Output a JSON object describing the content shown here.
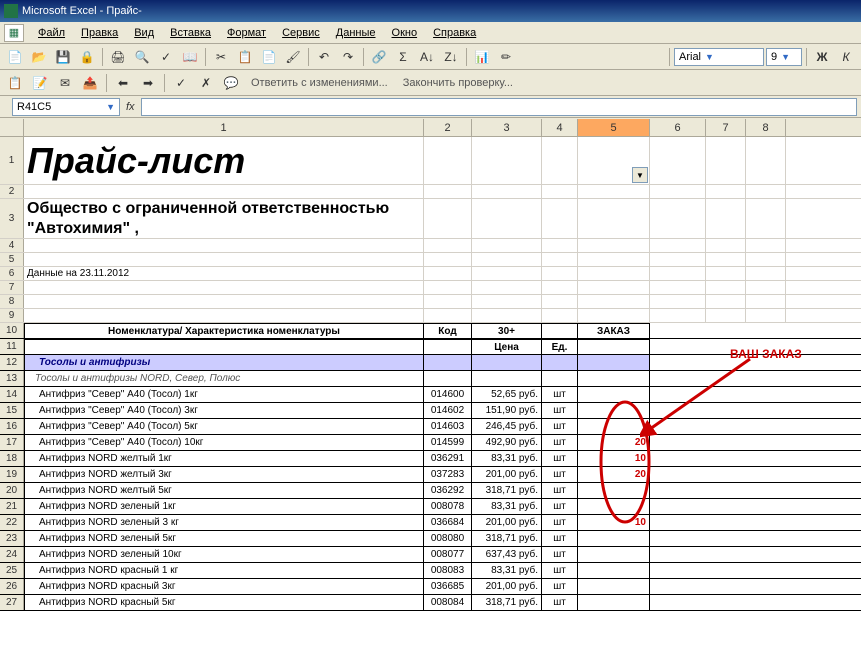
{
  "app_title": "Microsoft Excel - Прайс-",
  "menu": [
    "Файл",
    "Правка",
    "Вид",
    "Вставка",
    "Формат",
    "Сервис",
    "Данные",
    "Окно",
    "Справка"
  ],
  "review_bar": {
    "reply": "Ответить с изменениями...",
    "end": "Закончить проверку..."
  },
  "font": {
    "name": "Arial",
    "size": "9"
  },
  "format_buttons": {
    "bold": "Ж",
    "italic": "К"
  },
  "namebox": "R41C5",
  "col_numbers": [
    "1",
    "2",
    "3",
    "4",
    "5",
    "6",
    "7",
    "8"
  ],
  "title": "Прайс-лист",
  "company": "Общество с ограниченной ответственностью  \"Автохимия\"  ,",
  "date_line": "Данные на 23.11.2012",
  "headers": {
    "nomen": "Номенклатура/ Характеристика номенклатуры",
    "code": "Код",
    "thirty": "30+",
    "price": "Цена",
    "unit": "Ед.",
    "order": "ЗАКАЗ"
  },
  "section": "Тосолы и антифризы",
  "group": "Тосолы и антифризы NORD, Север, Полюс",
  "rows": [
    {
      "n": "14",
      "name": "Антифриз \"Север\" А40 (Тосол)   1кг",
      "code": "014600",
      "price": "52,65 руб.",
      "unit": "шт",
      "order": ""
    },
    {
      "n": "15",
      "name": "Антифриз \"Север\" А40 (Тосол)   3кг",
      "code": "014602",
      "price": "151,90 руб.",
      "unit": "шт",
      "order": ""
    },
    {
      "n": "16",
      "name": "Антифриз \"Север\" А40 (Тосол)   5кг",
      "code": "014603",
      "price": "246,45 руб.",
      "unit": "шт",
      "order": ""
    },
    {
      "n": "17",
      "name": "Антифриз \"Север\" А40 (Тосол)  10кг",
      "code": "014599",
      "price": "492,90 руб.",
      "unit": "шт",
      "order": "20"
    },
    {
      "n": "18",
      "name": "Антифриз NORD желтый  1кг",
      "code": "036291",
      "price": "83,31 руб.",
      "unit": "шт",
      "order": "10"
    },
    {
      "n": "19",
      "name": "Антифриз NORD желтый  3кг",
      "code": "037283",
      "price": "201,00 руб.",
      "unit": "шт",
      "order": "20"
    },
    {
      "n": "20",
      "name": "Антифриз NORD желтый  5кг",
      "code": "036292",
      "price": "318,71 руб.",
      "unit": "шт",
      "order": ""
    },
    {
      "n": "21",
      "name": "Антифриз NORD зеленый  1кг",
      "code": "008078",
      "price": "83,31 руб.",
      "unit": "шт",
      "order": ""
    },
    {
      "n": "22",
      "name": "Антифриз NORD зеленый  3 кг",
      "code": "036684",
      "price": "201,00 руб.",
      "unit": "шт",
      "order": "10"
    },
    {
      "n": "23",
      "name": "Антифриз NORD зеленый  5кг",
      "code": "008080",
      "price": "318,71 руб.",
      "unit": "шт",
      "order": ""
    },
    {
      "n": "24",
      "name": "Антифриз NORD зеленый 10кг",
      "code": "008077",
      "price": "637,43 руб.",
      "unit": "шт",
      "order": ""
    },
    {
      "n": "25",
      "name": "Антифриз NORD красный  1 кг",
      "code": "008083",
      "price": "83,31 руб.",
      "unit": "шт",
      "order": ""
    },
    {
      "n": "26",
      "name": "Антифриз NORD красный  3кг",
      "code": "036685",
      "price": "201,00 руб.",
      "unit": "шт",
      "order": ""
    },
    {
      "n": "27",
      "name": "Антифриз NORD красный  5кг",
      "code": "008084",
      "price": "318,71 руб.",
      "unit": "шт",
      "order": ""
    }
  ],
  "annotation": {
    "label": "ВАШ ЗАКАЗ"
  }
}
